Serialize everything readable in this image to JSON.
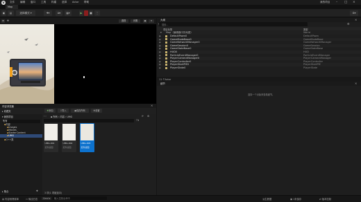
{
  "app": {
    "project_name": "我的项目",
    "tab_name": "Map",
    "logo_letter": "U"
  },
  "menu": [
    "文件",
    "编辑",
    "窗口",
    "工具",
    "构建",
    "选择",
    "Actor",
    "帮助"
  ],
  "toolbar": {
    "mode_label": "选择模式",
    "play_icon": "play-icon",
    "record_icon": "record-icon"
  },
  "viewport": {
    "perspective_label": "透视",
    "lit_label": "光照"
  },
  "outliner": {
    "title": "大纲",
    "search_placeholder": "搜索...",
    "col_label": "项目标签",
    "col_type": "类型",
    "root_label": "Map（编辑器中的地图）",
    "root_type": "World",
    "rows": [
      {
        "name": "DefaultPawn0",
        "type": "DefaultPawn"
      },
      {
        "name": "GameModeBase0",
        "type": "GameModeBase"
      },
      {
        "name": "GameNetworkManager0",
        "type": "GameNetworkManager"
      },
      {
        "name": "GameSession0",
        "type": "GameSession"
      },
      {
        "name": "GameStateBase0",
        "type": "GameStateBase"
      },
      {
        "name": "HUD0",
        "type": "HUD"
      },
      {
        "name": "ParticleEventManager0",
        "type": "ParticleEventManager"
      },
      {
        "name": "PlayerCameraManager0",
        "type": "PlayerCameraManager"
      },
      {
        "name": "PlayerController0",
        "type": "PlayerController"
      },
      {
        "name": "PlayerStartPIE0",
        "type": "PlayerStartPIE"
      },
      {
        "name": "PlayerState0",
        "type": "PlayerState"
      }
    ],
    "count_text": "11 个Actor"
  },
  "details": {
    "title": "细节",
    "empty_text": "选择一个对象来查看细节。"
  },
  "content_browser": {
    "title": "内容浏览器",
    "add_label": "添加",
    "import_label": "导入",
    "save_all_label": "保存所有",
    "settings_label": "设置",
    "favorites_label": "收藏夹",
    "project_label": "我的项目",
    "search_placeholder": "搜索 UMG",
    "path": [
      "所有",
      "内容",
      "UMG"
    ],
    "tree": [
      "所有",
      "内容",
      "Images",
      "Movies",
      "StarterContent",
      "UMG",
      "C++类"
    ],
    "assets": [
      {
        "name": "UMG-001",
        "type": "控件蓝图"
      },
      {
        "name": "UMG-002",
        "type": "控件蓝图"
      },
      {
        "name": "UMG-003",
        "type": "控件蓝图"
      }
    ],
    "status_text": "3 项(1 项被选中)",
    "collections_label": "集合"
  },
  "statusbar": {
    "drawer": "内容侧滑菜单",
    "output": "输出日志",
    "cmd": "Cmd",
    "console_placeholder": "输入控制台命令",
    "derived_data": "派生数据",
    "unsaved": "1未保存",
    "source_control": "版本控制"
  }
}
